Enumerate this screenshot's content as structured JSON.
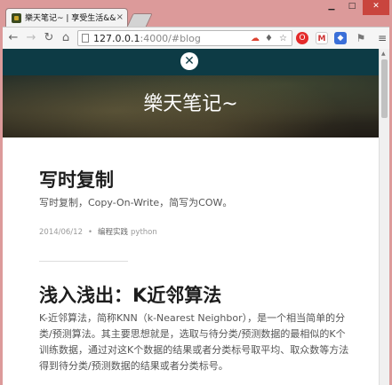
{
  "browser": {
    "tab_title": "樂天笔记~ | 享受生活&&",
    "url_host": "127.0.0.1",
    "url_rest": ":4000/#blog",
    "window_min": "▁",
    "window_max": "□",
    "window_close": "✕"
  },
  "blog": {
    "site_title": "樂天笔记~",
    "posts": [
      {
        "title": "写时复制",
        "excerpt": "写时复制，Copy-On-Write，简写为COW。",
        "date": "2014/06/12",
        "separator": "•",
        "category": "编程实践",
        "tag": "python"
      },
      {
        "title": "浅入浅出：K近邻算法",
        "excerpt": "K-近邻算法，简称KNN（k-Nearest Neighbor），是一个相当简单的分类/预测算法。其主要思想就是，选取与待分类/预测数据的最相似的K个训练数据，通过对这K个数据的结果或者分类标号取平均、取众数等方法得到待分类/预测数据的结果或者分类标号。"
      }
    ]
  },
  "colors": {
    "header_bar": "#0d3b45",
    "window_frame": "#dc9a9a",
    "close_button": "#c9453e"
  }
}
